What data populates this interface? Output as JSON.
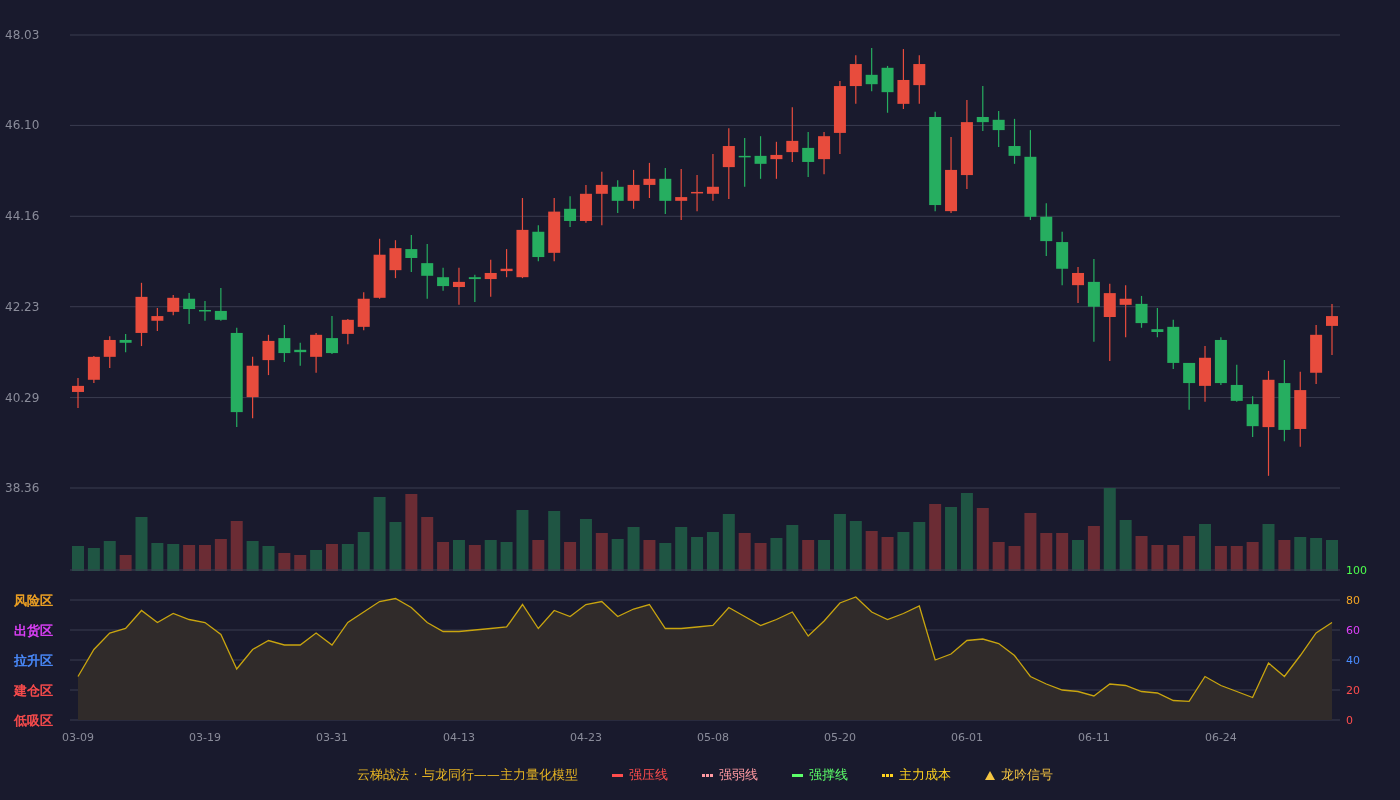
{
  "price_chart": {
    "chart_data": {
      "type": "candlestick",
      "grid": true,
      "ylim": [
        38.36,
        48.03
      ],
      "yticks": [
        {
          "value": 48.03,
          "label": "48.03"
        },
        {
          "value": 46.1,
          "label": "46.10"
        },
        {
          "value": 44.16,
          "label": "44.16"
        },
        {
          "value": 42.23,
          "label": "42.23"
        },
        {
          "value": 40.29,
          "label": "40.29"
        },
        {
          "value": 38.36,
          "label": "38.36"
        }
      ],
      "ohlc": [
        [
          40.41,
          40.71,
          40.07,
          40.54
        ],
        [
          40.67,
          41.18,
          40.6,
          41.16
        ],
        [
          41.16,
          41.6,
          40.92,
          41.52
        ],
        [
          41.52,
          41.65,
          41.26,
          41.46
        ],
        [
          41.67,
          42.74,
          41.39,
          42.44
        ],
        [
          41.93,
          42.2,
          41.71,
          42.03
        ],
        [
          42.12,
          42.48,
          42.05,
          42.42
        ],
        [
          42.4,
          42.52,
          41.86,
          42.18
        ],
        [
          42.16,
          42.35,
          41.93,
          42.14
        ],
        [
          42.14,
          42.63,
          41.93,
          41.95
        ],
        [
          41.67,
          41.78,
          39.66,
          39.98
        ],
        [
          40.3,
          41.16,
          39.85,
          40.97
        ],
        [
          41.09,
          41.63,
          40.77,
          41.5
        ],
        [
          41.56,
          41.84,
          41.05,
          41.24
        ],
        [
          41.31,
          41.46,
          40.97,
          41.26
        ],
        [
          41.16,
          41.67,
          40.82,
          41.63
        ],
        [
          41.56,
          42.03,
          41.22,
          41.24
        ],
        [
          41.65,
          41.97,
          41.43,
          41.95
        ],
        [
          41.8,
          42.54,
          41.73,
          42.4
        ],
        [
          42.42,
          43.68,
          42.4,
          43.34
        ],
        [
          43.01,
          43.65,
          42.84,
          43.48
        ],
        [
          43.46,
          43.76,
          42.97,
          43.27
        ],
        [
          43.16,
          43.57,
          42.4,
          42.89
        ],
        [
          42.86,
          43.06,
          42.57,
          42.67
        ],
        [
          42.65,
          43.06,
          42.27,
          42.76
        ],
        [
          42.86,
          42.91,
          42.33,
          42.82
        ],
        [
          42.82,
          43.23,
          42.44,
          42.95
        ],
        [
          42.99,
          43.46,
          42.86,
          43.04
        ],
        [
          42.86,
          44.55,
          42.84,
          43.87
        ],
        [
          43.83,
          43.97,
          43.2,
          43.29
        ],
        [
          43.38,
          44.55,
          43.2,
          44.26
        ],
        [
          44.32,
          44.59,
          43.93,
          44.06
        ],
        [
          44.06,
          44.83,
          44.02,
          44.64
        ],
        [
          44.64,
          45.11,
          43.97,
          44.83
        ],
        [
          44.79,
          44.93,
          44.23,
          44.49
        ],
        [
          44.49,
          45.15,
          44.32,
          44.83
        ],
        [
          44.83,
          45.3,
          44.55,
          44.96
        ],
        [
          44.96,
          45.19,
          44.21,
          44.49
        ],
        [
          44.49,
          45.17,
          44.08,
          44.57
        ],
        [
          44.66,
          45.04,
          44.27,
          44.68
        ],
        [
          44.64,
          45.49,
          44.49,
          44.79
        ],
        [
          45.21,
          46.04,
          44.53,
          45.66
        ],
        [
          45.45,
          45.83,
          44.79,
          45.43
        ],
        [
          45.45,
          45.87,
          44.96,
          45.28
        ],
        [
          45.38,
          45.75,
          44.96,
          45.47
        ],
        [
          45.53,
          46.49,
          45.32,
          45.77
        ],
        [
          45.62,
          45.96,
          45.0,
          45.32
        ],
        [
          45.38,
          45.96,
          45.06,
          45.87
        ],
        [
          45.94,
          47.05,
          45.49,
          46.94
        ],
        [
          46.94,
          47.6,
          46.56,
          47.41
        ],
        [
          47.18,
          47.75,
          46.83,
          46.98
        ],
        [
          47.33,
          47.37,
          46.37,
          46.81
        ],
        [
          46.56,
          47.73,
          46.45,
          47.07
        ],
        [
          46.96,
          47.6,
          46.56,
          47.41
        ],
        [
          46.28,
          46.39,
          44.27,
          44.4
        ],
        [
          44.27,
          45.85,
          44.23,
          45.15
        ],
        [
          45.04,
          46.64,
          44.74,
          46.17
        ],
        [
          46.28,
          46.94,
          45.98,
          46.17
        ],
        [
          46.22,
          46.41,
          45.64,
          46.0
        ],
        [
          45.66,
          46.24,
          45.28,
          45.45
        ],
        [
          45.43,
          46.0,
          44.08,
          44.15
        ],
        [
          44.15,
          44.44,
          43.31,
          43.63
        ],
        [
          43.61,
          43.83,
          42.69,
          43.04
        ],
        [
          42.69,
          43.08,
          42.31,
          42.95
        ],
        [
          42.76,
          43.25,
          41.48,
          42.23
        ],
        [
          42.01,
          42.72,
          41.07,
          42.52
        ],
        [
          42.27,
          42.69,
          41.58,
          42.4
        ],
        [
          42.29,
          42.46,
          41.78,
          41.88
        ],
        [
          41.75,
          42.2,
          41.58,
          41.69
        ],
        [
          41.8,
          41.95,
          40.9,
          41.03
        ],
        [
          41.03,
          41.03,
          40.03,
          40.6
        ],
        [
          40.54,
          41.39,
          40.2,
          41.14
        ],
        [
          41.52,
          41.58,
          40.56,
          40.6
        ],
        [
          40.56,
          40.99,
          40.2,
          40.22
        ],
        [
          40.15,
          40.32,
          39.45,
          39.68
        ],
        [
          39.66,
          40.86,
          38.62,
          40.67
        ],
        [
          40.6,
          41.09,
          39.36,
          39.6
        ],
        [
          39.62,
          40.84,
          39.24,
          40.45
        ],
        [
          40.82,
          41.84,
          40.58,
          41.63
        ],
        [
          41.82,
          42.29,
          41.2,
          42.03
        ]
      ]
    }
  },
  "indicator_chart": {
    "zones": [
      {
        "label": "风险区",
        "color": "#f5a623"
      },
      {
        "label": "出货区",
        "color": "#e040fb"
      },
      {
        "label": "拉升区",
        "color": "#4a8cff"
      },
      {
        "label": "建仓区",
        "color": "#ff4d4d"
      },
      {
        "label": "低吸区",
        "color": "#ff4d4d"
      }
    ],
    "chart_data": {
      "type": "area",
      "grid": true,
      "ylim": [
        0,
        100
      ],
      "yticks": [
        0,
        20,
        40,
        60,
        80,
        100
      ],
      "categories": [
        "03-09",
        null,
        null,
        null,
        null,
        null,
        null,
        null,
        "03-19",
        null,
        null,
        null,
        null,
        null,
        null,
        null,
        "03-31",
        null,
        null,
        null,
        null,
        null,
        null,
        null,
        "04-13",
        null,
        null,
        null,
        null,
        null,
        null,
        null,
        "04-23",
        null,
        null,
        null,
        null,
        null,
        null,
        null,
        "05-08",
        null,
        null,
        null,
        null,
        null,
        null,
        null,
        "05-20",
        null,
        null,
        null,
        null,
        null,
        null,
        null,
        "06-01",
        null,
        null,
        null,
        null,
        null,
        null,
        null,
        "06-11",
        null,
        null,
        null,
        null,
        null,
        null,
        null,
        "06-24",
        null,
        null,
        null,
        null,
        null,
        null,
        null
      ],
      "values": [
        29,
        47,
        58,
        61,
        73,
        65,
        71,
        67,
        65,
        57,
        34,
        47,
        53,
        50,
        50,
        58,
        50,
        65,
        72,
        79,
        81,
        75,
        65,
        59,
        59,
        60,
        61,
        62,
        77,
        61,
        73,
        69,
        77,
        79,
        69,
        74,
        77,
        61,
        61,
        62,
        63,
        75,
        69,
        63,
        67,
        72,
        56,
        66,
        78,
        82,
        72,
        67,
        71,
        76,
        40,
        44,
        53,
        54,
        51,
        43,
        29,
        24,
        20,
        19,
        16,
        24,
        23,
        19,
        18,
        13,
        12.5,
        29,
        23,
        19,
        15,
        38,
        29,
        43,
        58,
        65
      ]
    }
  },
  "legend": {
    "title": "云梯战法 · 与龙同行——主力量化模型",
    "items": [
      {
        "label": "强压线",
        "kind": "solid",
        "color": "#ff4d4d"
      },
      {
        "label": "强弱线",
        "kind": "dashed",
        "color": "#ff9aa2"
      },
      {
        "label": "强撑线",
        "kind": "solid",
        "color": "#5cff6a"
      },
      {
        "label": "主力成本",
        "kind": "dashed",
        "color": "#ffd21f"
      },
      {
        "label": "龙吟信号",
        "kind": "triangle",
        "color": "#f5c542"
      }
    ]
  }
}
